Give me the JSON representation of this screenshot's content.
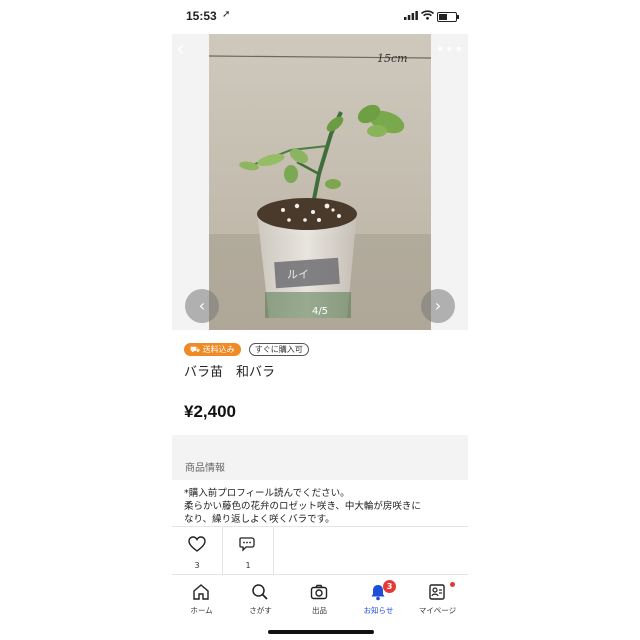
{
  "status": {
    "time": "15:53"
  },
  "gallery": {
    "counter": "4/5",
    "photo_note": "15cm",
    "pot_label": "ルイ"
  },
  "item": {
    "badge_shipping": "送料込み",
    "badge_buy_now": "すぐに購入可",
    "title": "バラ苗　和バラ",
    "price": "¥2,400"
  },
  "description": {
    "section_label": "商品情報",
    "lines": [
      "*購入前プロフィール読んでください。",
      "柔らかい藤色の花弁のロゼット咲き、中大輪が房咲きに",
      "なり、繰り返しよく咲くバラです。"
    ]
  },
  "actions": {
    "like_count": "3",
    "comment_count": "1"
  },
  "tabbar": {
    "home": "ホーム",
    "search": "さがす",
    "sell": "出品",
    "notifications": "お知らせ",
    "notifications_badge": "3",
    "mypage": "マイページ"
  },
  "colors": {
    "accent": "#1d4ed8",
    "shipping_badge": "#f08a24",
    "notification": "#e53935"
  }
}
